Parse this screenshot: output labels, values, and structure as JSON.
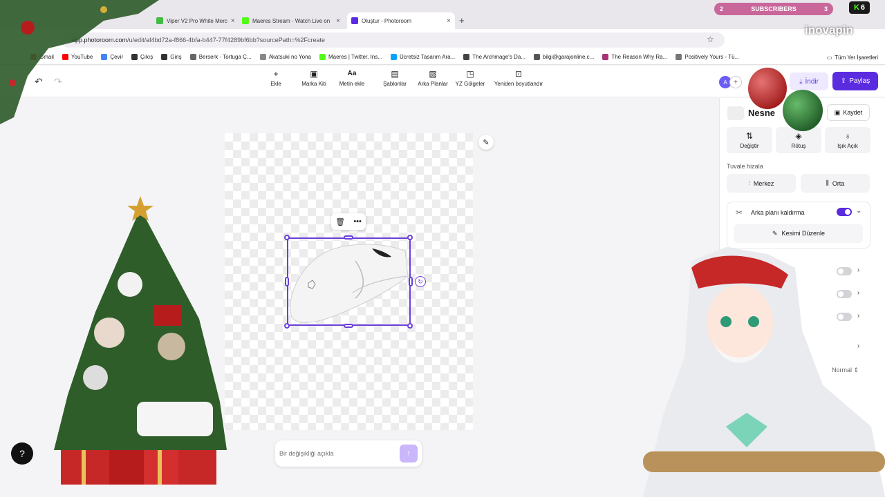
{
  "browser": {
    "tabs": [
      {
        "title": "Viper V2 Pro White Merc",
        "favicon_color": "#44bb44"
      },
      {
        "title": "Maeres Stream - Watch Live on",
        "favicon_color": "#53fc18"
      },
      {
        "title": "Oluştur - Photoroom",
        "favicon_color": "#5b2be0"
      }
    ],
    "url_host": "app.photoroom.com",
    "url_path": "/u/edit/af4bd72a-f866-4bfa-b447-77f4289bf6bb?sourcePath=%2Fcreate",
    "bookmarks": [
      {
        "label": "Gmail",
        "color": "#ea4335"
      },
      {
        "label": "YouTube",
        "color": "#ff0000"
      },
      {
        "label": "Çevir",
        "color": "#4285f4"
      },
      {
        "label": "Çıkış",
        "color": "#333333"
      },
      {
        "label": "Giriş",
        "color": "#333333"
      },
      {
        "label": "Berserk - Tortuga Ç...",
        "color": "#666666"
      },
      {
        "label": "Akatsuki no Yona",
        "color": "#888888"
      },
      {
        "label": "Maeres | Twitter, Ins...",
        "color": "#53fc18"
      },
      {
        "label": "Ücretsiz Tasarım Ara...",
        "color": "#00a3ff"
      },
      {
        "label": "The Archmage's Da...",
        "color": "#444444"
      },
      {
        "label": "bilgi@garajonline.c...",
        "color": "#555555"
      },
      {
        "label": "The Reason Why Ra...",
        "color": "#aa3377"
      },
      {
        "label": "Positively Yours - Tü...",
        "color": "#777777"
      }
    ],
    "all_bookmarks": "Tüm Yer İşaretleri"
  },
  "toolbar": {
    "tools": [
      {
        "label": "Ekle",
        "icon": "+"
      },
      {
        "label": "Marka Kiti",
        "icon": "▣"
      },
      {
        "label": "Metin ekle",
        "icon": "Aa"
      },
      {
        "label": "Şablonlar",
        "icon": "▤"
      },
      {
        "label": "Arka Planlar",
        "icon": "▨"
      },
      {
        "label": "YZ Gölgeler",
        "icon": "◳"
      },
      {
        "label": "Yeniden boyutlandır",
        "icon": "⊡"
      }
    ],
    "avatar_initial": "A",
    "download_label": "İndir",
    "share_label": "Paylaş"
  },
  "editor": {
    "prompt_placeholder": "Bir değişikliği açıkla"
  },
  "panel": {
    "title": "Nesne",
    "save_label": "Kaydet",
    "actions": [
      {
        "label": "Değiştir",
        "icon": "⇅"
      },
      {
        "label": "Rötuş",
        "icon": "◈"
      },
      {
        "label": "Işık Açık",
        "icon": "♁"
      }
    ],
    "align_label": "Tuvale hizala",
    "align_center": "Merkez",
    "align_middle": "Orta",
    "bg_removal_label": "Arka planı kaldırma",
    "bg_removal_on": true,
    "edit_cut_label": "Kesimi Düzenle",
    "toggles_off": [
      false,
      false,
      false
    ],
    "blend_mode": "Normal"
  },
  "overlay": {
    "subscribers_left": "2",
    "subscribers_label": "SUBSCRIBERS",
    "subscribers_right": "3",
    "k_count": "6",
    "brand": "inovapin"
  },
  "colors": {
    "accent": "#5b2be0",
    "selection": "#6b3fd8"
  }
}
